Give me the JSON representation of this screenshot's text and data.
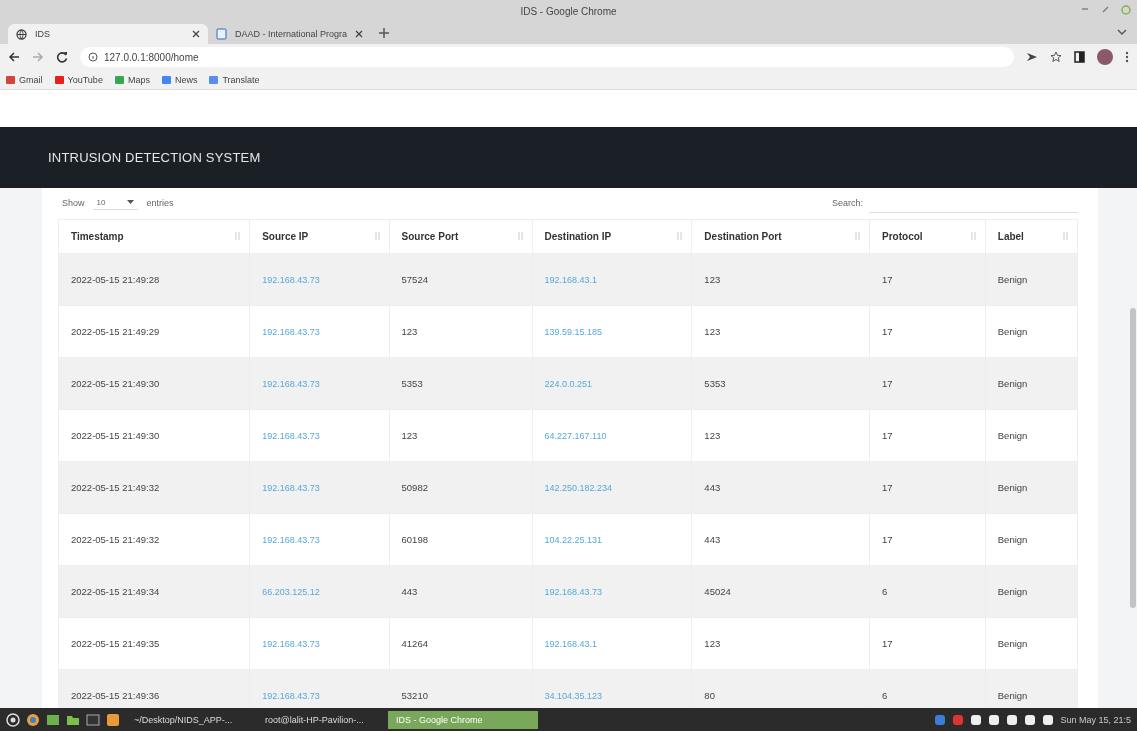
{
  "window": {
    "title": "IDS - Google Chrome"
  },
  "tabs": [
    {
      "label": "IDS",
      "selected": true
    },
    {
      "label": "DAAD - International Progra",
      "selected": false
    }
  ],
  "address_bar": {
    "url": "127.0.0.1:8000/home"
  },
  "bookmarks": [
    {
      "label": "Gmail",
      "color": "#d44638"
    },
    {
      "label": "YouTube",
      "color": "#e62117"
    },
    {
      "label": "Maps",
      "color": "#34a853"
    },
    {
      "label": "News",
      "color": "#4285f4"
    },
    {
      "label": "Translate",
      "color": "#5b8def"
    }
  ],
  "page": {
    "navbar_title": "INTRUSION DETECTION SYSTEM",
    "length": {
      "before": "Show",
      "value": "10",
      "after": "entries"
    },
    "search": {
      "label": "Search:"
    },
    "table": {
      "columns": [
        {
          "label": "Timestamp",
          "kind": "text"
        },
        {
          "label": "Source IP",
          "kind": "link"
        },
        {
          "label": "Source Port",
          "kind": "text"
        },
        {
          "label": "Destination IP",
          "kind": "link"
        },
        {
          "label": "Destination Port",
          "kind": "text"
        },
        {
          "label": "Protocol",
          "kind": "text"
        },
        {
          "label": "Label",
          "kind": "text"
        }
      ],
      "rows": [
        {
          "cells": [
            "2022-05-15 21:49:28",
            "192.168.43.73",
            "57524",
            "192.168.43.1",
            "123",
            "17",
            "Benign"
          ]
        },
        {
          "cells": [
            "2022-05-15 21:49:29",
            "192.168.43.73",
            "123",
            "139.59.15.185",
            "123",
            "17",
            "Benign"
          ]
        },
        {
          "cells": [
            "2022-05-15 21:49:30",
            "192.168.43.73",
            "5353",
            "224.0.0.251",
            "5353",
            "17",
            "Benign"
          ]
        },
        {
          "cells": [
            "2022-05-15 21:49:30",
            "192.168.43.73",
            "123",
            "64.227.167.110",
            "123",
            "17",
            "Benign"
          ]
        },
        {
          "cells": [
            "2022-05-15 21:49:32",
            "192.168.43.73",
            "50982",
            "142.250.182.234",
            "443",
            "17",
            "Benign"
          ]
        },
        {
          "cells": [
            "2022-05-15 21:49:32",
            "192.168.43.73",
            "60198",
            "104.22.25.131",
            "443",
            "17",
            "Benign"
          ]
        },
        {
          "cells": [
            "2022-05-15 21:49:34",
            "66.203.125.12",
            "443",
            "192.168.43.73",
            "45024",
            "6",
            "Benign"
          ]
        },
        {
          "cells": [
            "2022-05-15 21:49:35",
            "192.168.43.73",
            "41264",
            "192.168.43.1",
            "123",
            "17",
            "Benign"
          ]
        },
        {
          "cells": [
            "2022-05-15 21:49:36",
            "192.168.43.73",
            "53210",
            "34.104.35.123",
            "80",
            "6",
            "Benign"
          ]
        }
      ]
    }
  },
  "taskbar": {
    "windows": [
      {
        "label": "~/Desktop/NIDS_APP-...",
        "selected": false
      },
      {
        "label": "root@lalit-HP-Pavilion-...",
        "selected": false
      },
      {
        "label": "IDS - Google Chrome",
        "selected": true
      }
    ],
    "clock": "Sun May 15, 21:5"
  }
}
